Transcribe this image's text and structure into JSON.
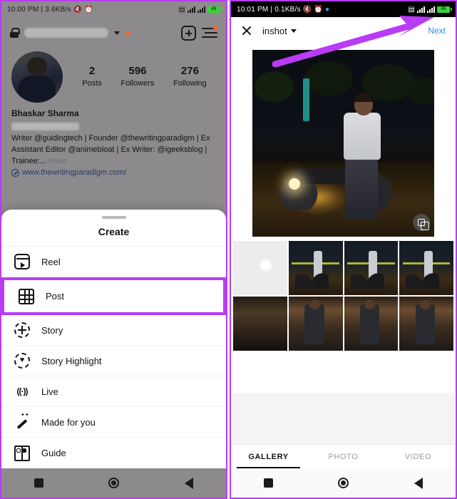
{
  "accent": {
    "highlight": "#b93cf5",
    "link": "#2b8ef0",
    "badge": "#e8643a"
  },
  "left_phone": {
    "status": {
      "time": "10:00 PM",
      "separator": "|",
      "net_speed": "3.6KB/s",
      "icons": [
        "mute-icon",
        "alarm-icon"
      ],
      "right_icons": [
        "vibrate-icon",
        "signal-icon",
        "signal-icon",
        "battery-icon"
      ],
      "battery_level": "45"
    },
    "header": {
      "lock_icon": "lock-icon",
      "username_blurred": "",
      "chevron": "chevron-down-icon",
      "new_badge": "red-dot",
      "add_icon": "plus-box-icon",
      "menu_icon": "hamburger-menu-icon"
    },
    "profile": {
      "name": "Bhaskar Sharma",
      "stats": [
        {
          "num": "2",
          "label": "Posts"
        },
        {
          "num": "596",
          "label": "Followers"
        },
        {
          "num": "276",
          "label": "Following"
        }
      ],
      "bio": "Writer @guidingtech | Founder @thewritingparadigm | Ex Assistant Editor @animebloat | Ex Writer: @igeeksblog | Trainee:...",
      "bio_more": " more",
      "link": "www.thewritingparadigm.com/"
    },
    "sheet": {
      "title": "Create",
      "items": [
        {
          "label": "Reel",
          "icon": "reel-icon"
        },
        {
          "label": "Post",
          "icon": "grid-icon",
          "highlighted": true
        },
        {
          "label": "Story",
          "icon": "story-plus-icon"
        },
        {
          "label": "Story Highlight",
          "icon": "story-highlight-icon"
        },
        {
          "label": "Live",
          "icon": "live-broadcast-icon"
        },
        {
          "label": "Made for you",
          "icon": "magic-wand-icon"
        },
        {
          "label": "Guide",
          "icon": "guide-book-icon"
        }
      ]
    },
    "navbar": [
      "recents-square-icon",
      "home-circle-icon",
      "back-triangle-icon"
    ]
  },
  "right_phone": {
    "status": {
      "time": "10:01 PM",
      "separator": "|",
      "net_speed": "0.1KB/s",
      "icons": [
        "mute-icon",
        "alarm-icon",
        "telegram-icon"
      ],
      "right_icons": [
        "vibrate-icon",
        "signal-4g-icon",
        "signal-icon",
        "battery-icon"
      ],
      "battery_level": "45"
    },
    "header": {
      "close_label": "close-icon",
      "album": "inshot",
      "album_chevron": "chevron-down-icon",
      "next_label": "Next"
    },
    "preview": {
      "alt": "man leaning on motorcycle at night",
      "multi_select_icon": "multi-select-layers-icon"
    },
    "gallery": {
      "thumbs": [
        {
          "kind": "faded",
          "alt": "faded night street"
        },
        {
          "kind": "bike",
          "alt": "man with motorcycle"
        },
        {
          "kind": "bike",
          "alt": "man standing by motorcycle"
        },
        {
          "kind": "bike",
          "alt": "man sitting on motorcycle"
        },
        {
          "kind": "dark",
          "alt": "dark elevator mirror selfie"
        },
        {
          "kind": "elev",
          "alt": "elevator selfie with backpack"
        },
        {
          "kind": "elev",
          "alt": "elevator selfie black shirt"
        },
        {
          "kind": "elev",
          "alt": "elevator selfie holding phone"
        }
      ]
    },
    "tabs": [
      {
        "label": "GALLERY",
        "active": true
      },
      {
        "label": "PHOTO",
        "active": false
      },
      {
        "label": "VIDEO",
        "active": false
      }
    ],
    "navbar": [
      "recents-square-icon",
      "home-circle-icon",
      "back-triangle-icon"
    ]
  }
}
